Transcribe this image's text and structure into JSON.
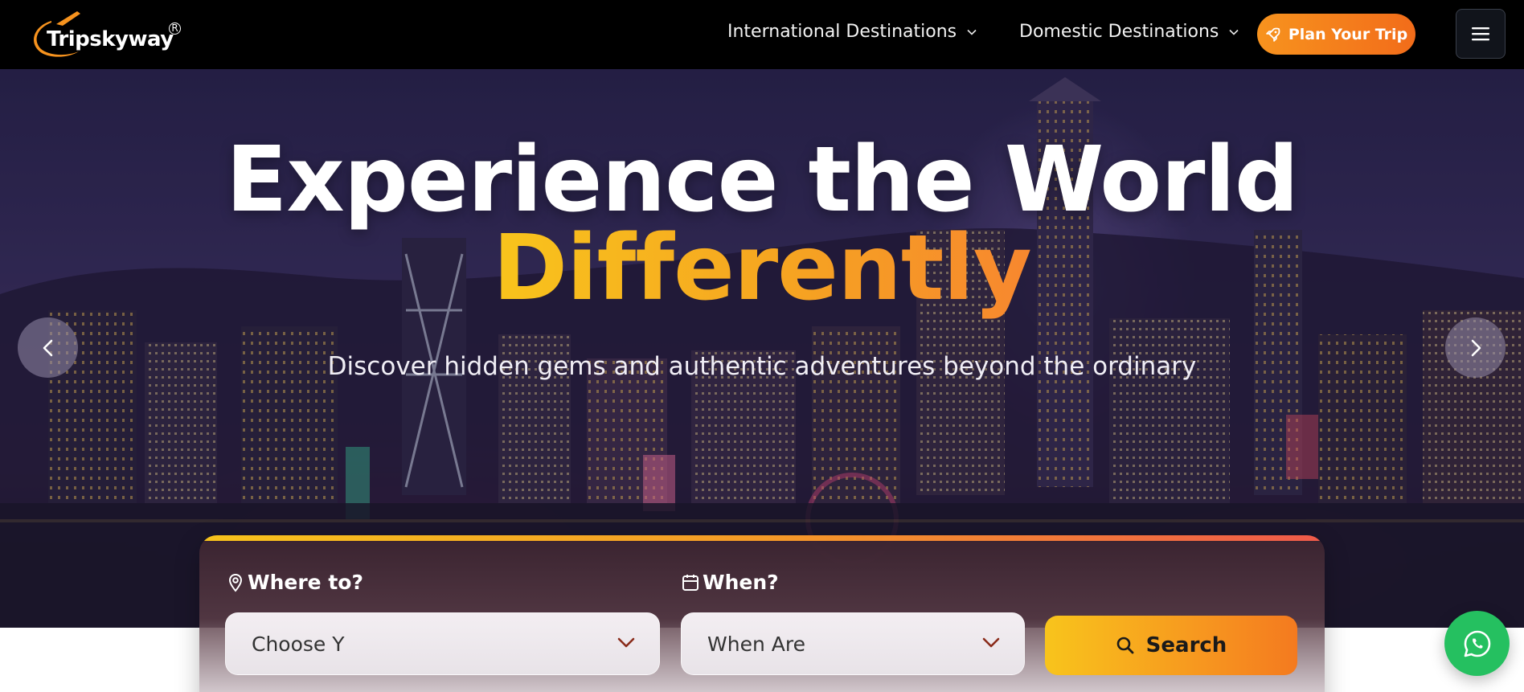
{
  "brand": {
    "name": "Tripskyway",
    "registered_mark": "R",
    "accent_color": "#f7931e"
  },
  "nav": {
    "items": [
      {
        "label": "International Destinations",
        "icon": "chevron-down-icon"
      },
      {
        "label": "Domestic Destinations",
        "icon": "chevron-down-icon"
      }
    ],
    "cta_label": "Plan Your Trip",
    "cta_icon": "rocket-icon",
    "menu_icon": "hamburger-menu-icon"
  },
  "hero": {
    "title_line1": "Experience the World",
    "title_line2": "Differently",
    "subtitle": "Discover hidden gems and authentic adventures beyond the ordinary",
    "prev_icon": "chevron-left-icon",
    "next_icon": "chevron-right-icon"
  },
  "search": {
    "where_label": "Where to?",
    "where_icon": "map-pin-icon",
    "where_value": "Choose Y",
    "when_label": "When?",
    "when_icon": "calendar-icon",
    "when_value": "When Are",
    "button_label": "Search",
    "button_icon": "search-icon"
  },
  "floating": {
    "chat_icon": "whatsapp-icon",
    "color": "#25c060"
  }
}
